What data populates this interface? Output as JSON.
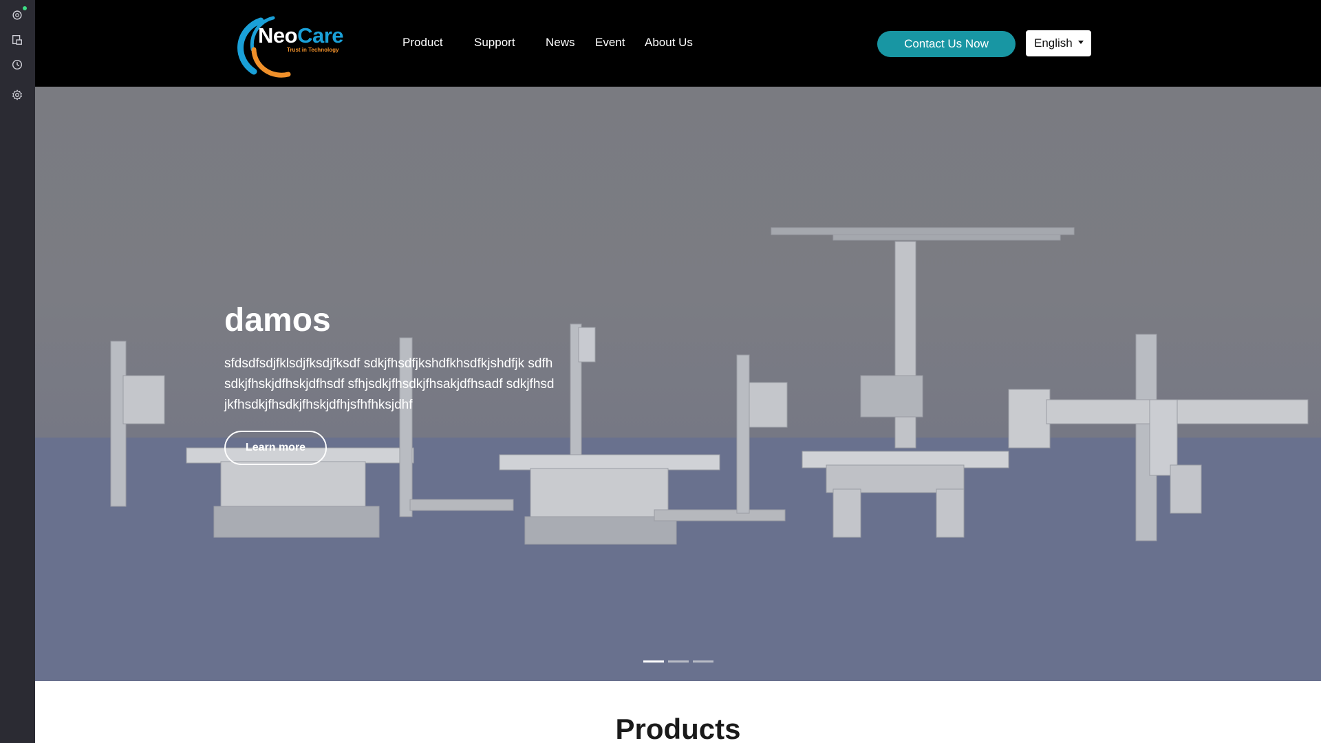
{
  "sidebar": {
    "icons": [
      "openai-icon",
      "save-page-icon",
      "history-icon",
      "settings-icon"
    ]
  },
  "header": {
    "logo": {
      "name_part1": "Neo",
      "name_part2": "Care",
      "tagline": "Trust in Technology"
    },
    "nav": [
      "Product",
      "Support",
      "News",
      "Event",
      "About Us"
    ],
    "contact_label": "Contact Us Now",
    "language": "English"
  },
  "hero": {
    "title": "damos",
    "description": "sfdsdfsdjfklsdjfksdjfksdf sdkjfhsdfjkshdfkhsdfkjshdfjk sdfhsdkjfhskjdfhskjdfhsdf sfhjsdkjfhsdkjfhsakjdfhsadf sdkjfhsdjkfhsdkjfhsdkjfhskjdfhjsfhfhksjdhf",
    "cta_label": "Learn more",
    "slides_total": 3,
    "active_slide": 1
  },
  "products": {
    "title": "Products"
  },
  "colors": {
    "header_bg": "#000000",
    "accent": "#1896a3",
    "logo_blue": "#1aa0d8",
    "logo_orange": "#f0902a",
    "sidebar_bg": "#2b2b33"
  }
}
